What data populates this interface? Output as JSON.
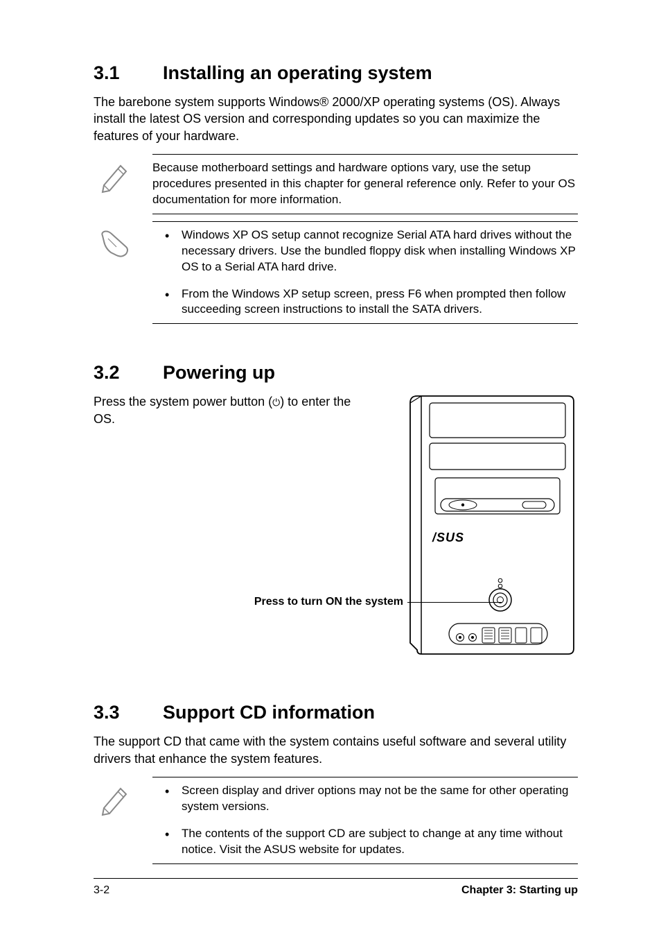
{
  "section31": {
    "num": "3.1",
    "title": "Installing an operating system",
    "intro": "The barebone system supports Windows® 2000/XP operating systems (OS). Always install the latest OS version and corresponding updates so you can maximize the features of your hardware.",
    "note1": "Because motherboard settings and hardware options vary, use the setup procedures presented in this chapter for general reference only. Refer to your OS documentation for more information.",
    "note2_item1": "Windows XP OS setup cannot recognize Serial ATA hard drives without the necessary drivers. Use the bundled floppy disk when installing Windows XP OS to a Serial ATA hard drive.",
    "note2_item2": "From the Windows XP setup screen, press F6 when prompted then follow succeeding screen instructions to install the SATA drivers."
  },
  "section32": {
    "num": "3.2",
    "title": "Powering up",
    "text_pre": "Press the system power button (",
    "text_post": ") to enter the OS.",
    "callout_label": "Press to turn ON the system",
    "tower_brand": "/SUS"
  },
  "section33": {
    "num": "3.3",
    "title": "Support CD information",
    "intro": "The support CD that came with the system contains useful software and several utility drivers that enhance the system features.",
    "note_item1": "Screen display and driver options may not be the same for other operating system versions.",
    "note_item2": "The contents of the support CD are subject to change at any time without notice. Visit the ASUS website for updates."
  },
  "footer": {
    "page": "3-2",
    "chapter": "Chapter 3: Starting up"
  }
}
